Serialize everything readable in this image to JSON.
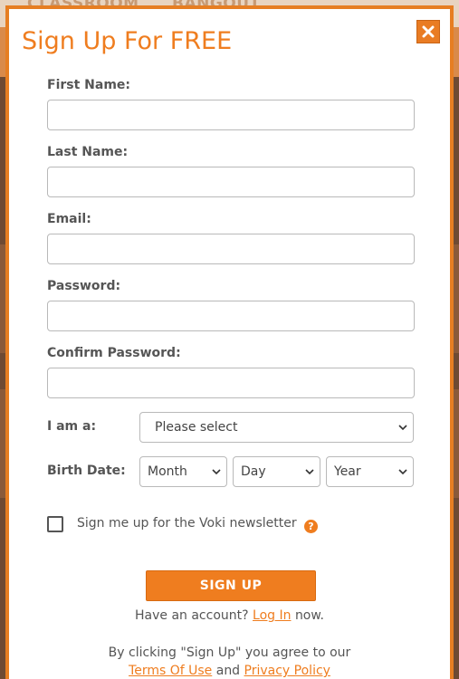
{
  "background": {
    "nav_items": [
      "CLASSROOM",
      "BANGOUT"
    ]
  },
  "modal": {
    "title": "Sign Up For FREE",
    "close_icon": "close-icon",
    "fields": {
      "first_name": {
        "label": "First Name:",
        "value": ""
      },
      "last_name": {
        "label": "Last Name:",
        "value": ""
      },
      "email": {
        "label": "Email:",
        "value": ""
      },
      "password": {
        "label": "Password:",
        "value": ""
      },
      "confirm_password": {
        "label": "Confirm Password:",
        "value": ""
      }
    },
    "role": {
      "label": "I am a:",
      "selected": "Please select"
    },
    "birth_date": {
      "label": "Birth Date:",
      "month": "Month",
      "day": "Day",
      "year": "Year"
    },
    "newsletter": {
      "label": "Sign me up for the Voki newsletter",
      "checked": false,
      "help": "?"
    },
    "submit_label": "SIGN UP",
    "account": {
      "prefix": "Have an account?",
      "link": "Log In",
      "suffix": "now."
    },
    "agreement": {
      "text": "By clicking \"Sign Up\" you agree to our",
      "terms_link": "Terms Of Use",
      "and": "and",
      "privacy_link": "Privacy Policy"
    }
  },
  "colors": {
    "accent": "#ef7d1f",
    "border": "#e67e22",
    "label": "#555555"
  }
}
